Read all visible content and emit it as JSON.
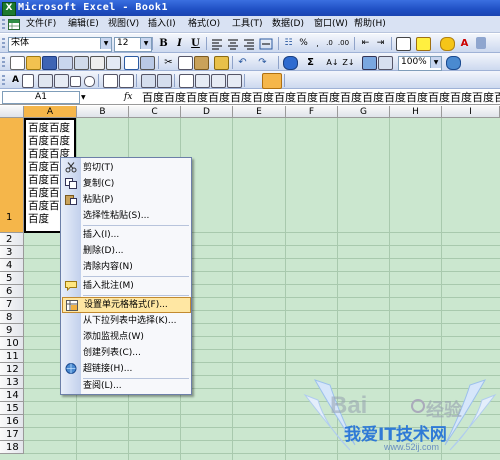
{
  "window": {
    "title": "Microsoft Excel - Book1",
    "app_icon": "X"
  },
  "menu": [
    "文件(F)",
    "编辑(E)",
    "视图(V)",
    "插入(I)",
    "格式(O)",
    "工具(T)",
    "数据(D)",
    "窗口(W)",
    "帮助(H)"
  ],
  "format_toolbar": {
    "font_name": "宋体",
    "font_size": "12",
    "bold": "B",
    "italic": "I",
    "underline": "U"
  },
  "standard_toolbar": {
    "zoom": "100%",
    "sum": "Σ"
  },
  "formula_bar": {
    "name_box": "A1",
    "fx": "fx",
    "content": "百度百度百度百度百度百度百度百度百度百度百度百度百度百度百度百度百度百度百度百度"
  },
  "columns": [
    "A",
    "B",
    "C",
    "D",
    "E",
    "F",
    "G",
    "H",
    "I"
  ],
  "rows": [
    "1",
    "2",
    "3",
    "4",
    "5",
    "6",
    "7",
    "8",
    "9",
    "10",
    "11",
    "12",
    "13",
    "14",
    "15",
    "16",
    "17",
    "18"
  ],
  "cell_a1_lines": [
    "百度百度",
    "百度百度",
    "百度百度",
    "百度百",
    "百度百",
    "百度百",
    "百度百",
    "百度"
  ],
  "context_menu": {
    "items": [
      {
        "label": "剪切(T)",
        "icon": "scissors-icon"
      },
      {
        "label": "复制(C)",
        "icon": "copy-icon"
      },
      {
        "label": "粘贴(P)",
        "icon": "paste-icon"
      },
      {
        "label": "选择性粘贴(S)...",
        "icon": ""
      },
      {
        "label": "插入(I)...",
        "icon": ""
      },
      {
        "label": "删除(D)...",
        "icon": ""
      },
      {
        "label": "清除内容(N)",
        "icon": ""
      },
      {
        "label": "插入批注(M)",
        "icon": "comment-icon"
      },
      {
        "label": "设置单元格格式(F)...",
        "icon": "format-cells-icon"
      },
      {
        "label": "从下拉列表中选择(K)...",
        "icon": ""
      },
      {
        "label": "添加监视点(W)",
        "icon": ""
      },
      {
        "label": "创建列表(C)...",
        "icon": ""
      },
      {
        "label": "超链接(H)...",
        "icon": "hyperlink-icon"
      },
      {
        "label": "查阅(L)...",
        "icon": ""
      }
    ]
  },
  "watermark": {
    "brand": "Bai",
    "brand2": "经验",
    "site": "我爱IT技术网",
    "url": "www.52ij.com"
  },
  "colors": {
    "title_bar": "#1f4fc4",
    "grid_bg": "#cbe7cf",
    "selection_header": "#f5b64a",
    "menu_highlight": "#ffe7a3"
  }
}
